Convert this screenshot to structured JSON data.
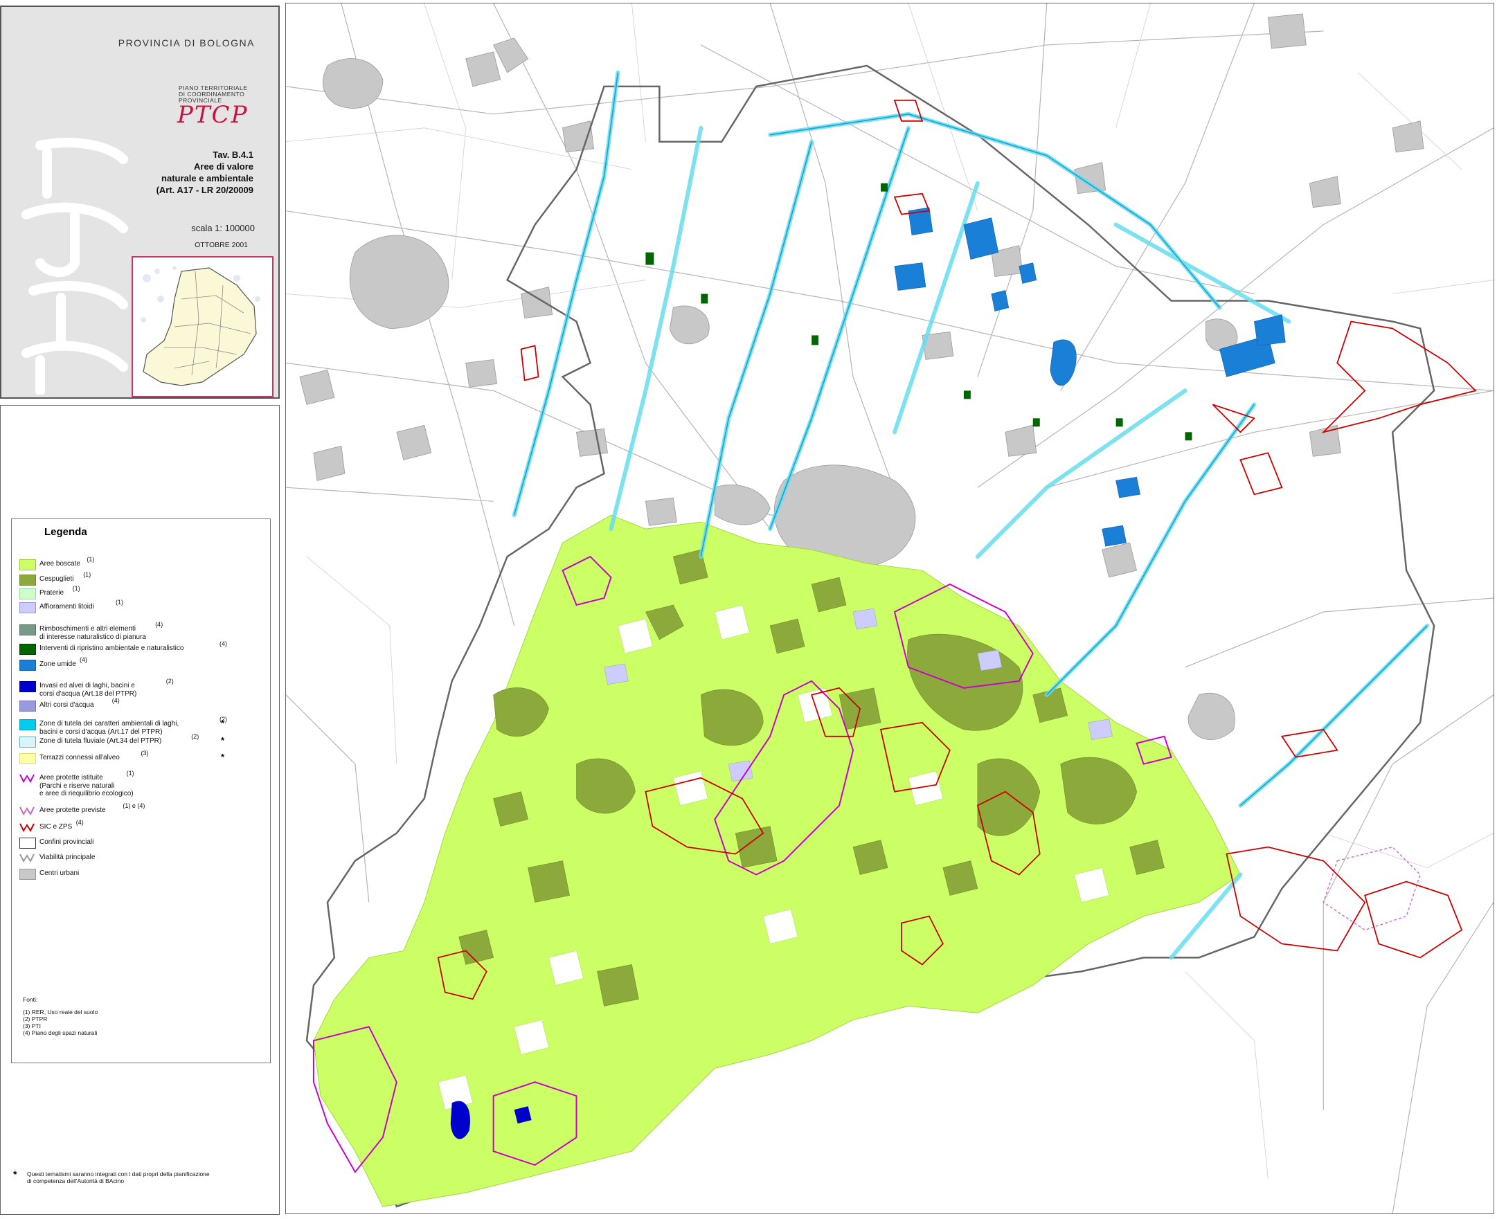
{
  "header": {
    "province": "PROVINCIA DI BOLOGNA",
    "piano": [
      "PIANO TERRITORIALE",
      "DI COORDINAMENTO",
      "PROVINCIALE"
    ],
    "logo": "PTCP",
    "tav_lines": [
      "Tav. B.4.1",
      "Aree di valore",
      "naturale e ambientale",
      "(Art. A17 - LR 20/20009"
    ],
    "scale": "scala 1: 100000",
    "date": "OTTOBRE 2001"
  },
  "legend": {
    "title": "Legenda",
    "items": [
      {
        "label": "Aree boscate",
        "note": "(1)",
        "color": "#ccff66",
        "border": "#99cc33",
        "star": ""
      },
      {
        "label": "Cespuglieti",
        "note": "(1)",
        "color": "#8caa3c",
        "border": "#6b8a2a",
        "star": ""
      },
      {
        "label": "Praterie",
        "note": "(1)",
        "color": "#ccffcc",
        "border": "#99dd99",
        "star": ""
      },
      {
        "label": "Affioramenti litoidi",
        "note": "(1)",
        "color": "#ccccff",
        "border": "#9999cc",
        "star": ""
      },
      {
        "label": "Rimboschimenti e altri elementi\ndi interesse naturalistico di pianura",
        "note": "(4)",
        "color": "#779988",
        "border": "#557766",
        "star": ""
      },
      {
        "label": "Interventi di ripristino ambientale e naturalistico",
        "note": "(4)",
        "color": "#006600",
        "border": "#004400",
        "star": ""
      },
      {
        "label": "Zone umide",
        "note": "(4)",
        "color": "#1a7fd6",
        "border": "#0e5fa8",
        "star": ""
      },
      {
        "label": "Invasi ed alvei di laghi, bacini e\ncorsi d'acqua (Art.18 del PTPR)",
        "note": "(2)",
        "color": "#0000cc",
        "border": "#000099",
        "star": ""
      },
      {
        "label": "Altri corsi d'acqua",
        "note": "(4)",
        "color": "#9999dd",
        "border": "#7777bb",
        "star": ""
      },
      {
        "label": "Zone di tutela dei caratteri ambientali di laghi,\nbacini e corsi d'acqua (Art.17 del PTPR)",
        "note": "(2)",
        "color": "#00ccee",
        "border": "#00a6c4",
        "star": "*"
      },
      {
        "label": "Zone di tutela fluviale (Art.34 del PTPR)",
        "note": "(2)",
        "color": "#d9f5f7",
        "border": "#66aabb",
        "star": "*"
      },
      {
        "label": "Terrazzi connessi all'alveo",
        "note": "(3)",
        "color": "#ffffaa",
        "border": "#dddd77",
        "star": "*"
      },
      {
        "label": "Aree protette istituite\n(Parchi e riserve naturali\ne aree di riequilibrio ecologico)",
        "note": "(1)",
        "color": "",
        "border": "#cc00cc",
        "star": ""
      },
      {
        "label": "Aree protette previste",
        "note": "(1) e (4)",
        "color": "",
        "border": "#cc66cc",
        "star": ""
      },
      {
        "label": "SIC e ZPS",
        "note": "(4)",
        "color": "",
        "border": "#cc0000",
        "star": ""
      },
      {
        "label": "Confini provinciali",
        "note": "",
        "color": "#ffffff",
        "border": "#333333",
        "star": ""
      },
      {
        "label": "Viabilità principale",
        "note": "",
        "color": "",
        "border": "#999999",
        "star": ""
      },
      {
        "label": "Centri urbani",
        "note": "",
        "color": "#c8c8c8",
        "border": "#999999",
        "star": ""
      }
    ],
    "sources_title": "Fonti:",
    "sources": [
      "(1) RER, Uso reale del suolo",
      "(2) PTPR",
      "(3) PTI",
      "(4) Piano degli spazi naturali"
    ],
    "footnote": "Questi tematismi saranno integrati con i dati propri della pianificazione\ndi competenza dell'Autorità di BAcino"
  },
  "map": {
    "colors": {
      "urban": "#c8c8c8",
      "woods": "#ccff66",
      "shrubs": "#8caa3c",
      "wetlands": "#1a7fd6",
      "river_zone": "#66ddee",
      "protected": "#cc00cc",
      "sic": "#cc0000",
      "roads": "#999999",
      "border": "#555555"
    }
  }
}
